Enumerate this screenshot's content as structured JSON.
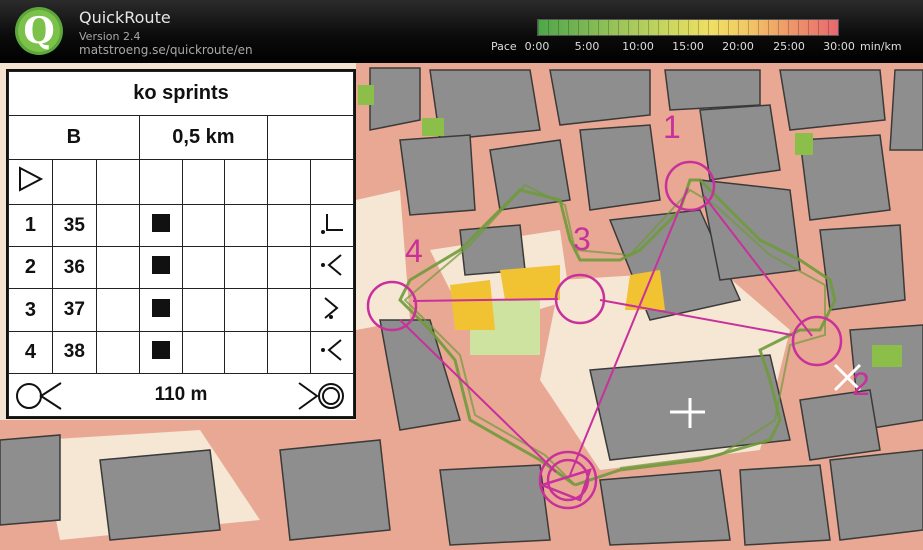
{
  "header": {
    "app_name": "QuickRoute",
    "version": "Version 2.4",
    "url": "matstroeng.se/quickroute/en",
    "logo_letter": "Q"
  },
  "pace": {
    "label": "Pace",
    "ticks": [
      "0:00",
      "5:00",
      "10:00",
      "15:00",
      "20:00",
      "25:00",
      "30:00"
    ],
    "unit": "min/km"
  },
  "control_card": {
    "title": "ko sprints",
    "category": "B",
    "distance": "0,5 km",
    "controls": [
      {
        "number": "1",
        "code": "35"
      },
      {
        "number": "2",
        "code": "36"
      },
      {
        "number": "3",
        "code": "37"
      },
      {
        "number": "4",
        "code": "38"
      }
    ],
    "finish_distance": "110 m"
  },
  "map_labels": [
    "1",
    "2",
    "3",
    "4"
  ],
  "colors": {
    "course": "#c8309c",
    "route": "#6f9a3c",
    "building": "#8f8f8f",
    "street": "#e7a08f",
    "open_land": "#f3e2cf"
  }
}
